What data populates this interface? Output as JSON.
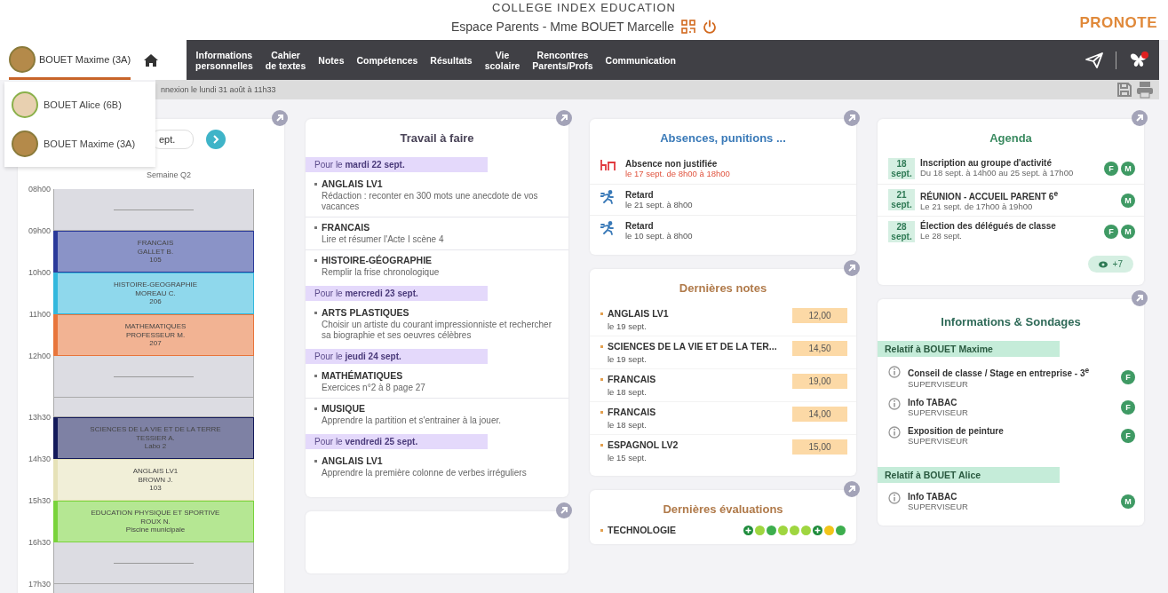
{
  "header": {
    "school": "COLLEGE INDEX EDUCATION",
    "space": "Espace Parents - Mme BOUET Marcelle",
    "logo": "PRONOTE"
  },
  "child_selector": {
    "name": "BOUET Maxime (3A)"
  },
  "child_menu": [
    {
      "name": "BOUET Alice (6B)"
    },
    {
      "name": "BOUET Maxime (3A)"
    }
  ],
  "nav": [
    {
      "label": "Informations\npersonnelles"
    },
    {
      "label": "Cahier\nde textes"
    },
    {
      "label": "Notes"
    },
    {
      "label": "Compétences"
    },
    {
      "label": "Résultats"
    },
    {
      "label": "Vie\nscolaire"
    },
    {
      "label": "Rencontres\nParents/Profs"
    },
    {
      "label": "Communication"
    }
  ],
  "last_connection": "nnexion le lundi 31 août à 11h33",
  "timetable": {
    "date_value": "ept.",
    "week": "Semaine Q2",
    "slots": [
      {
        "time": "08h00",
        "kind": "free"
      },
      {
        "time": "09h00",
        "kind": "course",
        "lines": [
          "FRANCAIS",
          "GALLET B.",
          "105"
        ],
        "color": "#2b3a9a"
      },
      {
        "time": "10h00",
        "kind": "course",
        "lines": [
          "HISTOIRE-GEOGRAPHIE",
          "MOREAU C.",
          "206"
        ],
        "color": "#33b8dd"
      },
      {
        "time": "11h00",
        "kind": "course",
        "lines": [
          "MATHEMATIQUES",
          "PROFESSEUR M.",
          "207"
        ],
        "color": "#e8753b"
      },
      {
        "time": "12h00",
        "kind": "free"
      },
      {
        "kind": "break"
      },
      {
        "time": "13h30",
        "kind": "course",
        "lines": [
          "SCIENCES DE LA VIE ET DE LA TERRE",
          "TESSIER A.",
          "Labo 2"
        ],
        "color": "#141a5a"
      },
      {
        "time": "14h30",
        "kind": "course",
        "lines": [
          "ANGLAIS LV1",
          "BROWN J.",
          "103"
        ],
        "color": "#e6e2b8"
      },
      {
        "time": "15h30",
        "kind": "course",
        "lines": [
          "EDUCATION PHYSIQUE ET SPORTIVE",
          "ROUX N.",
          "Piscine municipale"
        ],
        "color": "#79d33b"
      },
      {
        "time": "16h30",
        "kind": "free"
      },
      {
        "time": "17h30",
        "kind": "free"
      }
    ]
  },
  "homework": {
    "title": "Travail à faire",
    "groups": [
      {
        "date": "Pour le **mardi 22 sept.**",
        "items": [
          {
            "subject": "ANGLAIS LV1",
            "text": "Rédaction : reconter en 300 mots une anecdote de vos vacances"
          },
          {
            "subject": "FRANCAIS",
            "text": "Lire et résumer l'Acte I scène 4"
          },
          {
            "subject": "HISTOIRE-GÉOGRAPHIE",
            "text": "Remplir la frise chronologique"
          }
        ]
      },
      {
        "date": "Pour le **mercredi 23 sept.**",
        "items": [
          {
            "subject": "ARTS PLASTIQUES",
            "text": "Choisir un artiste du courant impressionniste et rechercher sa biographie et ses oeuvres célèbres"
          }
        ]
      },
      {
        "date": "Pour le **jeudi 24 sept.**",
        "items": [
          {
            "subject": "MATHÉMATIQUES",
            "text": "Exercices n°2 à 8 page 27"
          },
          {
            "subject": "MUSIQUE",
            "text": "Apprendre la partition et s'entrainer à la jouer."
          }
        ]
      },
      {
        "date": "Pour le **vendredi 25 sept.**",
        "items": [
          {
            "subject": "ANGLAIS LV1",
            "text": "Apprendre la première colonne de verbes irréguliers"
          }
        ]
      }
    ]
  },
  "absences": {
    "title": "Absences, punitions ...",
    "items": [
      {
        "kind": "absence",
        "title": "Absence non justifiée",
        "detail": "le 17 sept. de 8h00 à 18h00"
      },
      {
        "kind": "late",
        "title": "Retard",
        "detail": "le 21 sept. à 8h00"
      },
      {
        "kind": "late",
        "title": "Retard",
        "detail": "le 10 sept. à 8h00"
      }
    ]
  },
  "grades": {
    "title": "Dernières notes",
    "items": [
      {
        "subject": "ANGLAIS LV1",
        "date": "le 19 sept.",
        "grade": "12,00"
      },
      {
        "subject": "SCIENCES DE LA VIE ET DE LA TER...",
        "date": "le 19 sept.",
        "grade": "14,50"
      },
      {
        "subject": "FRANCAIS",
        "date": "le 18 sept.",
        "grade": "19,00"
      },
      {
        "subject": "FRANCAIS",
        "date": "le 18 sept.",
        "grade": "14,00"
      },
      {
        "subject": "ESPAGNOL LV2",
        "date": "le 15 sept.",
        "grade": "15,00"
      }
    ]
  },
  "evaluations": {
    "title": "Dernières évaluations",
    "items": [
      {
        "subject": "TECHNOLOGIE",
        "dots": [
          {
            "color": "#1e8c3c",
            "kind": "plus"
          },
          {
            "color": "#9fd640",
            "kind": "plain"
          },
          {
            "color": "#3dae4e",
            "kind": "plain"
          },
          {
            "color": "#9fd640",
            "kind": "plain"
          },
          {
            "color": "#9fd640",
            "kind": "plain"
          },
          {
            "color": "#9fd640",
            "kind": "plain"
          },
          {
            "color": "#1e8c3c",
            "kind": "plus"
          },
          {
            "color": "#f2c41a",
            "kind": "plain"
          },
          {
            "color": "#3dae4e",
            "kind": "plain"
          }
        ]
      }
    ]
  },
  "agenda": {
    "title": "Agenda",
    "events": [
      {
        "day": "18",
        "month": "sept.",
        "title": "Inscription au groupe d'activité",
        "detail": "Du 18 sept. à 14h00 au 25 sept. à 17h00",
        "badges": [
          "F",
          "M"
        ]
      },
      {
        "day": "21",
        "month": "sept.",
        "title": "RÉUNION - ACCUEIL PARENT 6$^{e}$",
        "detail": "Le 21 sept. de 17h00 à 19h00",
        "badges": [
          "M"
        ]
      },
      {
        "day": "28",
        "month": "sept.",
        "title": "Élection des délégués de classe",
        "detail": "Le 28 sept.",
        "badges": [
          "F",
          "M"
        ]
      }
    ],
    "more": "+7"
  },
  "info": {
    "title": "Informations & Sondages",
    "groups": [
      {
        "heading": "Relatif à BOUET Maxime",
        "items": [
          {
            "title": "Conseil de classe / Stage en entreprise - 3$^{e}$",
            "author": "SUPERVISEUR",
            "badges": [
              "F"
            ]
          },
          {
            "title": "Info TABAC",
            "author": "SUPERVISEUR",
            "badges": [
              "F"
            ]
          },
          {
            "title": "Exposition de peinture",
            "author": "SUPERVISEUR",
            "badges": [
              "F"
            ]
          }
        ]
      },
      {
        "heading": "Relatif à BOUET Alice",
        "items": [
          {
            "title": "Info TABAC",
            "author": "SUPERVISEUR",
            "badges": [
              "M"
            ]
          }
        ]
      }
    ]
  }
}
